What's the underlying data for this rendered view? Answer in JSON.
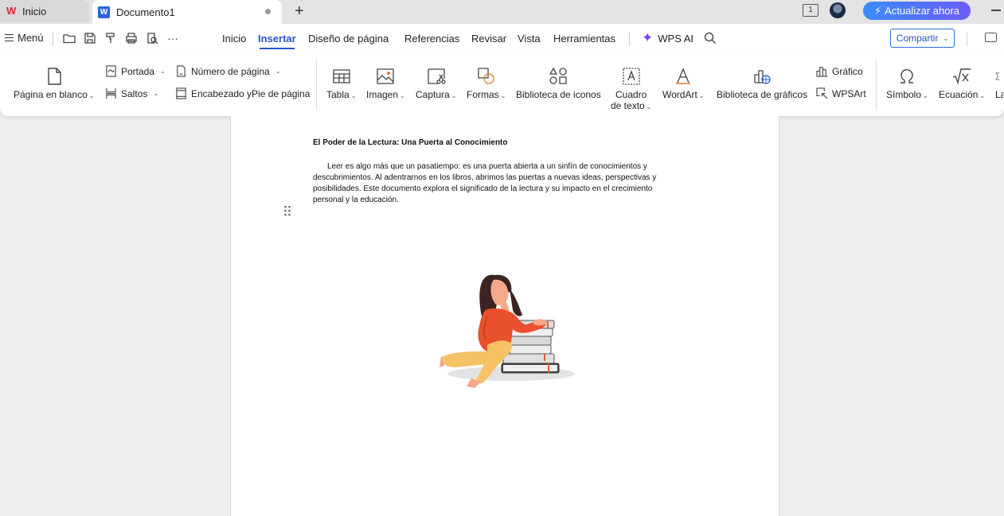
{
  "tabs": {
    "home_label": "Inicio",
    "doc_label": "Documento1",
    "new_tab": "+"
  },
  "window": {
    "page_indicator": "1",
    "upgrade_label": "Actualizar ahora"
  },
  "menubar": {
    "menu_label": "Menú",
    "more": "···",
    "tabs": [
      {
        "label": "Inicio"
      },
      {
        "label": "Insertar"
      },
      {
        "label": "Diseño de página"
      },
      {
        "label": "Referencias"
      },
      {
        "label": "Revisar"
      },
      {
        "label": "Vista"
      },
      {
        "label": "Herramientas"
      }
    ],
    "active_tab": "Insertar",
    "wps_ai": "WPS AI",
    "share_label": "Compartir"
  },
  "ribbon": {
    "blank_page": "Página en blanco",
    "cover": "Portada",
    "breaks": "Saltos",
    "page_number": "Número de página",
    "header_footer": "Encabezado yPie de página",
    "table": "Tabla",
    "image": "Imagen",
    "capture": "Captura",
    "shapes": "Formas",
    "icon_library": "Biblioteca de iconos",
    "text_box_1": "Cuadro",
    "text_box_2": "de texto",
    "wordart": "WordArt",
    "chart_library": "Biblioteca de gráficos",
    "chart": "Gráfico",
    "wpsart": "WPSArt",
    "symbol": "Símbolo",
    "equation": "Ecuación",
    "cut_label": "La"
  },
  "document": {
    "title": "El Poder de la Lectura: Una Puerta al Conocimiento",
    "paragraph": "Leer es algo más que un pasatiempo: es una puerta abierta a un sinfín de conocimientos y descubrimientos. Al adentrarnos en los libros, abrimos las puertas a nuevas ideas, perspectivas y posibilidades. Este documento explora el significado de la lectura y su impacto en el crecimiento personal y la educación."
  },
  "colors": {
    "accent": "#2456c8",
    "wps_red": "#e0282d",
    "upgrade_start": "#3b8cff",
    "upgrade_end": "#6a5cff",
    "ai_purple": "#7b3ff2"
  }
}
